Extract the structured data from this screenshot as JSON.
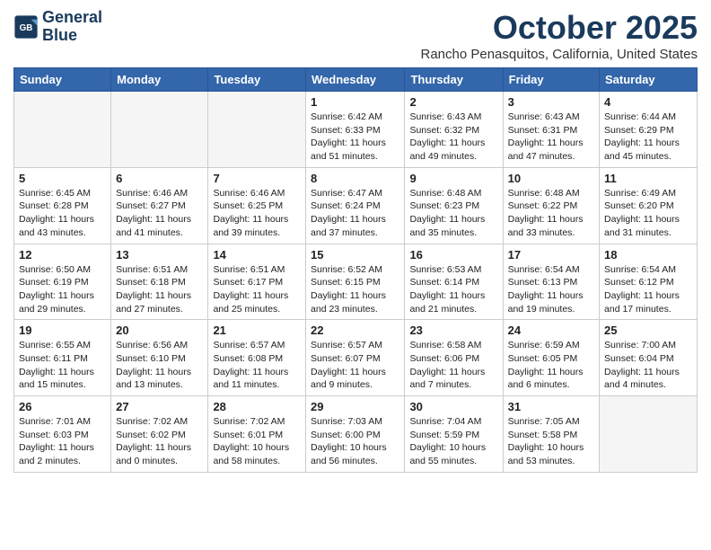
{
  "header": {
    "logo_line1": "General",
    "logo_line2": "Blue",
    "month": "October 2025",
    "location": "Rancho Penasquitos, California, United States"
  },
  "days_of_week": [
    "Sunday",
    "Monday",
    "Tuesday",
    "Wednesday",
    "Thursday",
    "Friday",
    "Saturday"
  ],
  "weeks": [
    [
      {
        "day": "",
        "info": ""
      },
      {
        "day": "",
        "info": ""
      },
      {
        "day": "",
        "info": ""
      },
      {
        "day": "1",
        "info": "Sunrise: 6:42 AM\nSunset: 6:33 PM\nDaylight: 11 hours and 51 minutes."
      },
      {
        "day": "2",
        "info": "Sunrise: 6:43 AM\nSunset: 6:32 PM\nDaylight: 11 hours and 49 minutes."
      },
      {
        "day": "3",
        "info": "Sunrise: 6:43 AM\nSunset: 6:31 PM\nDaylight: 11 hours and 47 minutes."
      },
      {
        "day": "4",
        "info": "Sunrise: 6:44 AM\nSunset: 6:29 PM\nDaylight: 11 hours and 45 minutes."
      }
    ],
    [
      {
        "day": "5",
        "info": "Sunrise: 6:45 AM\nSunset: 6:28 PM\nDaylight: 11 hours and 43 minutes."
      },
      {
        "day": "6",
        "info": "Sunrise: 6:46 AM\nSunset: 6:27 PM\nDaylight: 11 hours and 41 minutes."
      },
      {
        "day": "7",
        "info": "Sunrise: 6:46 AM\nSunset: 6:25 PM\nDaylight: 11 hours and 39 minutes."
      },
      {
        "day": "8",
        "info": "Sunrise: 6:47 AM\nSunset: 6:24 PM\nDaylight: 11 hours and 37 minutes."
      },
      {
        "day": "9",
        "info": "Sunrise: 6:48 AM\nSunset: 6:23 PM\nDaylight: 11 hours and 35 minutes."
      },
      {
        "day": "10",
        "info": "Sunrise: 6:48 AM\nSunset: 6:22 PM\nDaylight: 11 hours and 33 minutes."
      },
      {
        "day": "11",
        "info": "Sunrise: 6:49 AM\nSunset: 6:20 PM\nDaylight: 11 hours and 31 minutes."
      }
    ],
    [
      {
        "day": "12",
        "info": "Sunrise: 6:50 AM\nSunset: 6:19 PM\nDaylight: 11 hours and 29 minutes."
      },
      {
        "day": "13",
        "info": "Sunrise: 6:51 AM\nSunset: 6:18 PM\nDaylight: 11 hours and 27 minutes."
      },
      {
        "day": "14",
        "info": "Sunrise: 6:51 AM\nSunset: 6:17 PM\nDaylight: 11 hours and 25 minutes."
      },
      {
        "day": "15",
        "info": "Sunrise: 6:52 AM\nSunset: 6:15 PM\nDaylight: 11 hours and 23 minutes."
      },
      {
        "day": "16",
        "info": "Sunrise: 6:53 AM\nSunset: 6:14 PM\nDaylight: 11 hours and 21 minutes."
      },
      {
        "day": "17",
        "info": "Sunrise: 6:54 AM\nSunset: 6:13 PM\nDaylight: 11 hours and 19 minutes."
      },
      {
        "day": "18",
        "info": "Sunrise: 6:54 AM\nSunset: 6:12 PM\nDaylight: 11 hours and 17 minutes."
      }
    ],
    [
      {
        "day": "19",
        "info": "Sunrise: 6:55 AM\nSunset: 6:11 PM\nDaylight: 11 hours and 15 minutes."
      },
      {
        "day": "20",
        "info": "Sunrise: 6:56 AM\nSunset: 6:10 PM\nDaylight: 11 hours and 13 minutes."
      },
      {
        "day": "21",
        "info": "Sunrise: 6:57 AM\nSunset: 6:08 PM\nDaylight: 11 hours and 11 minutes."
      },
      {
        "day": "22",
        "info": "Sunrise: 6:57 AM\nSunset: 6:07 PM\nDaylight: 11 hours and 9 minutes."
      },
      {
        "day": "23",
        "info": "Sunrise: 6:58 AM\nSunset: 6:06 PM\nDaylight: 11 hours and 7 minutes."
      },
      {
        "day": "24",
        "info": "Sunrise: 6:59 AM\nSunset: 6:05 PM\nDaylight: 11 hours and 6 minutes."
      },
      {
        "day": "25",
        "info": "Sunrise: 7:00 AM\nSunset: 6:04 PM\nDaylight: 11 hours and 4 minutes."
      }
    ],
    [
      {
        "day": "26",
        "info": "Sunrise: 7:01 AM\nSunset: 6:03 PM\nDaylight: 11 hours and 2 minutes."
      },
      {
        "day": "27",
        "info": "Sunrise: 7:02 AM\nSunset: 6:02 PM\nDaylight: 11 hours and 0 minutes."
      },
      {
        "day": "28",
        "info": "Sunrise: 7:02 AM\nSunset: 6:01 PM\nDaylight: 10 hours and 58 minutes."
      },
      {
        "day": "29",
        "info": "Sunrise: 7:03 AM\nSunset: 6:00 PM\nDaylight: 10 hours and 56 minutes."
      },
      {
        "day": "30",
        "info": "Sunrise: 7:04 AM\nSunset: 5:59 PM\nDaylight: 10 hours and 55 minutes."
      },
      {
        "day": "31",
        "info": "Sunrise: 7:05 AM\nSunset: 5:58 PM\nDaylight: 10 hours and 53 minutes."
      },
      {
        "day": "",
        "info": ""
      }
    ]
  ]
}
